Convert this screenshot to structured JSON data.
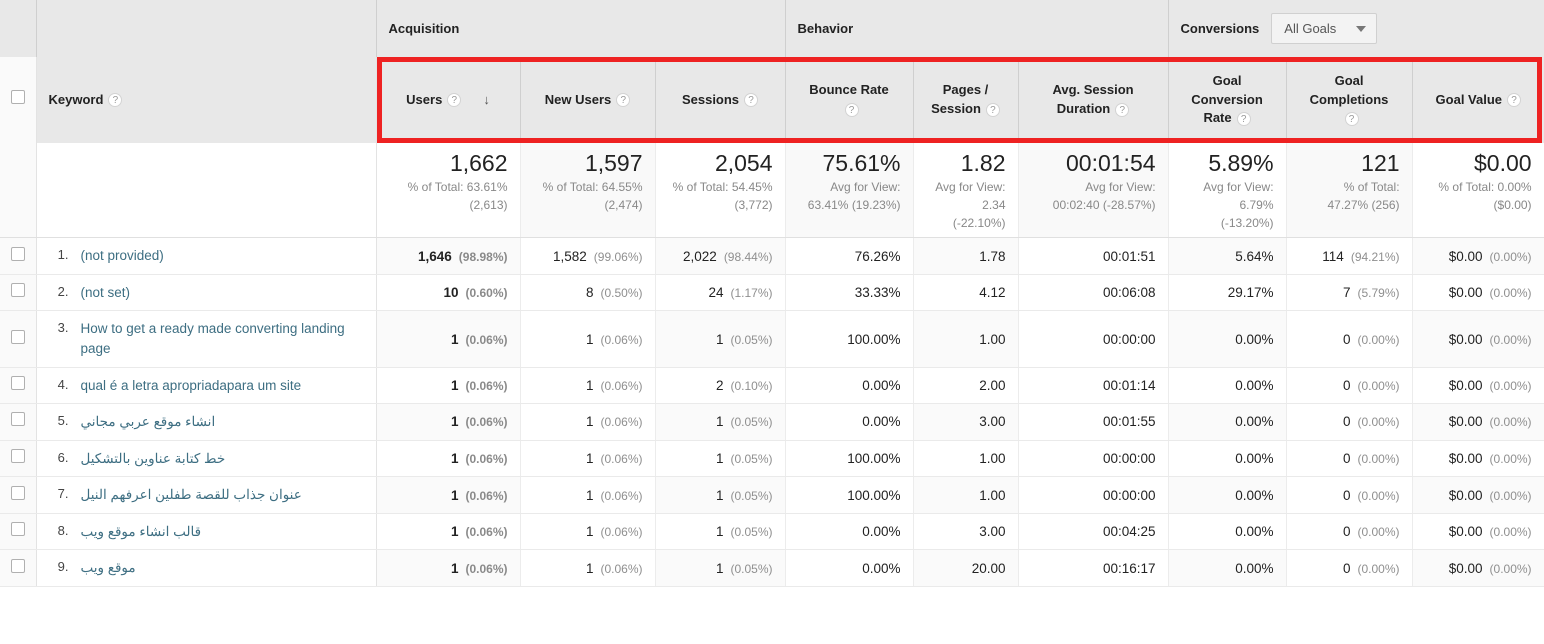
{
  "header": {
    "groups": {
      "acquisition": "Acquisition",
      "behavior": "Behavior",
      "conversions": "Conversions",
      "goal_select_value": "All Goals"
    },
    "columns": {
      "keyword": "Keyword",
      "users": "Users",
      "new_users": "New Users",
      "sessions": "Sessions",
      "bounce_rate": "Bounce Rate",
      "pages_session_l1": "Pages /",
      "pages_session_l2": "Session",
      "avg_session_l1": "Avg. Session",
      "avg_session_l2": "Duration",
      "goal_conv_l1": "Goal",
      "goal_conv_l2": "Conversion",
      "goal_conv_l3": "Rate",
      "goal_comp_l1": "Goal",
      "goal_comp_l2": "Completions",
      "goal_value": "Goal Value"
    },
    "help_glyph": "?",
    "sort_arrow_glyph": "↓"
  },
  "totals": {
    "users": {
      "value": "1,662",
      "sub": [
        "% of Total: 63.61%",
        "(2,613)"
      ]
    },
    "new_users": {
      "value": "1,597",
      "sub": [
        "% of Total: 64.55%",
        "(2,474)"
      ]
    },
    "sessions": {
      "value": "2,054",
      "sub": [
        "% of Total: 54.45%",
        "(3,772)"
      ]
    },
    "bounce": {
      "value": "75.61%",
      "sub": [
        "Avg for View:",
        "63.41% (19.23%)"
      ]
    },
    "pages": {
      "value": "1.82",
      "sub": [
        "Avg for View:",
        "2.34",
        "(-22.10%)"
      ]
    },
    "duration": {
      "value": "00:01:54",
      "sub": [
        "Avg for View:",
        "00:02:40 (-28.57%)"
      ]
    },
    "goal_rate": {
      "value": "5.89%",
      "sub": [
        "Avg for View:",
        "6.79%",
        "(-13.20%)"
      ]
    },
    "goal_comp": {
      "value": "121",
      "sub": [
        "% of Total:",
        "47.27% (256)"
      ]
    },
    "goal_value": {
      "value": "$0.00",
      "sub": [
        "% of Total: 0.00%",
        "($0.00)"
      ]
    }
  },
  "rows": [
    {
      "index": "1.",
      "keyword": "(not provided)",
      "rtl": false,
      "users": "1,646",
      "users_pct": "(98.98%)",
      "new_users": "1,582",
      "new_users_pct": "(99.06%)",
      "sessions": "2,022",
      "sessions_pct": "(98.44%)",
      "bounce": "76.26%",
      "pages": "1.78",
      "duration": "00:01:51",
      "goal_rate": "5.64%",
      "goal_comp": "114",
      "goal_comp_pct": "(94.21%)",
      "goal_value": "$0.00",
      "goal_value_pct": "(0.00%)"
    },
    {
      "index": "2.",
      "keyword": "(not set)",
      "rtl": false,
      "users": "10",
      "users_pct": "(0.60%)",
      "new_users": "8",
      "new_users_pct": "(0.50%)",
      "sessions": "24",
      "sessions_pct": "(1.17%)",
      "bounce": "33.33%",
      "pages": "4.12",
      "duration": "00:06:08",
      "goal_rate": "29.17%",
      "goal_comp": "7",
      "goal_comp_pct": "(5.79%)",
      "goal_value": "$0.00",
      "goal_value_pct": "(0.00%)"
    },
    {
      "index": "3.",
      "keyword": "How to get a ready made converting landing page",
      "rtl": false,
      "users": "1",
      "users_pct": "(0.06%)",
      "new_users": "1",
      "new_users_pct": "(0.06%)",
      "sessions": "1",
      "sessions_pct": "(0.05%)",
      "bounce": "100.00%",
      "pages": "1.00",
      "duration": "00:00:00",
      "goal_rate": "0.00%",
      "goal_comp": "0",
      "goal_comp_pct": "(0.00%)",
      "goal_value": "$0.00",
      "goal_value_pct": "(0.00%)"
    },
    {
      "index": "4.",
      "keyword": "qual é a letra apropriadapara um site",
      "rtl": false,
      "users": "1",
      "users_pct": "(0.06%)",
      "new_users": "1",
      "new_users_pct": "(0.06%)",
      "sessions": "2",
      "sessions_pct": "(0.10%)",
      "bounce": "0.00%",
      "pages": "2.00",
      "duration": "00:01:14",
      "goal_rate": "0.00%",
      "goal_comp": "0",
      "goal_comp_pct": "(0.00%)",
      "goal_value": "$0.00",
      "goal_value_pct": "(0.00%)"
    },
    {
      "index": "5.",
      "keyword": "انشاء موقع عربي مجاني",
      "rtl": true,
      "users": "1",
      "users_pct": "(0.06%)",
      "new_users": "1",
      "new_users_pct": "(0.06%)",
      "sessions": "1",
      "sessions_pct": "(0.05%)",
      "bounce": "0.00%",
      "pages": "3.00",
      "duration": "00:01:55",
      "goal_rate": "0.00%",
      "goal_comp": "0",
      "goal_comp_pct": "(0.00%)",
      "goal_value": "$0.00",
      "goal_value_pct": "(0.00%)"
    },
    {
      "index": "6.",
      "keyword": "خط كتابة عناوين بالتشكيل",
      "rtl": true,
      "users": "1",
      "users_pct": "(0.06%)",
      "new_users": "1",
      "new_users_pct": "(0.06%)",
      "sessions": "1",
      "sessions_pct": "(0.05%)",
      "bounce": "100.00%",
      "pages": "1.00",
      "duration": "00:00:00",
      "goal_rate": "0.00%",
      "goal_comp": "0",
      "goal_comp_pct": "(0.00%)",
      "goal_value": "$0.00",
      "goal_value_pct": "(0.00%)"
    },
    {
      "index": "7.",
      "keyword": "عنوان جذاب للقصة طفلين اعرفهم النيل",
      "rtl": true,
      "users": "1",
      "users_pct": "(0.06%)",
      "new_users": "1",
      "new_users_pct": "(0.06%)",
      "sessions": "1",
      "sessions_pct": "(0.05%)",
      "bounce": "100.00%",
      "pages": "1.00",
      "duration": "00:00:00",
      "goal_rate": "0.00%",
      "goal_comp": "0",
      "goal_comp_pct": "(0.00%)",
      "goal_value": "$0.00",
      "goal_value_pct": "(0.00%)"
    },
    {
      "index": "8.",
      "keyword": "قالب انشاء موقع ويب",
      "rtl": true,
      "users": "1",
      "users_pct": "(0.06%)",
      "new_users": "1",
      "new_users_pct": "(0.06%)",
      "sessions": "1",
      "sessions_pct": "(0.05%)",
      "bounce": "0.00%",
      "pages": "3.00",
      "duration": "00:04:25",
      "goal_rate": "0.00%",
      "goal_comp": "0",
      "goal_comp_pct": "(0.00%)",
      "goal_value": "$0.00",
      "goal_value_pct": "(0.00%)"
    },
    {
      "index": "9.",
      "keyword": "موقع ويب",
      "rtl": true,
      "users": "1",
      "users_pct": "(0.06%)",
      "new_users": "1",
      "new_users_pct": "(0.06%)",
      "sessions": "1",
      "sessions_pct": "(0.05%)",
      "bounce": "0.00%",
      "pages": "20.00",
      "duration": "00:16:17",
      "goal_rate": "0.00%",
      "goal_comp": "0",
      "goal_comp_pct": "(0.00%)",
      "goal_value": "$0.00",
      "goal_value_pct": "(0.00%)"
    }
  ],
  "annotation": {
    "highlight_color": "#ee2222"
  }
}
